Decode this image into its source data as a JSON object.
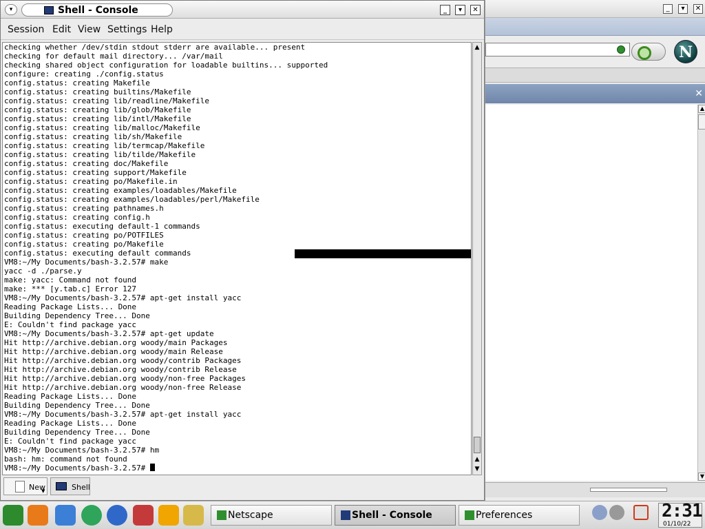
{
  "console_window": {
    "title": "Shell - Console",
    "menu": [
      "Session",
      "Edit",
      "View",
      "Settings",
      "Help"
    ],
    "lines": [
      "checking whether /dev/stdin stdout stderr are available... present",
      "checking for default mail directory... /var/mail",
      "checking shared object configuration for loadable builtins... supported",
      "configure: creating ./config.status",
      "config.status: creating Makefile",
      "config.status: creating builtins/Makefile",
      "config.status: creating lib/readline/Makefile",
      "config.status: creating lib/glob/Makefile",
      "config.status: creating lib/intl/Makefile",
      "config.status: creating lib/malloc/Makefile",
      "config.status: creating lib/sh/Makefile",
      "config.status: creating lib/termcap/Makefile",
      "config.status: creating lib/tilde/Makefile",
      "config.status: creating doc/Makefile",
      "config.status: creating support/Makefile",
      "config.status: creating po/Makefile.in",
      "config.status: creating examples/loadables/Makefile",
      "config.status: creating examples/loadables/perl/Makefile",
      "config.status: creating pathnames.h",
      "config.status: creating config.h",
      "config.status: executing default-1 commands",
      "config.status: creating po/POTFILES",
      "config.status: creating po/Makefile",
      "config.status: executing default commands",
      "VM8:~/My Documents/bash-3.2.57# make",
      "yacc -d ./parse.y",
      "make: yacc: Command not found",
      "make: *** [y.tab.c] Error 127",
      "VM8:~/My Documents/bash-3.2.57# apt-get install yacc",
      "Reading Package Lists... Done",
      "Building Dependency Tree... Done",
      "E: Couldn't find package yacc",
      "VM8:~/My Documents/bash-3.2.57# apt-get update",
      "Hit http://archive.debian.org woody/main Packages",
      "Hit http://archive.debian.org woody/main Release",
      "Hit http://archive.debian.org woody/contrib Packages",
      "Hit http://archive.debian.org woody/contrib Release",
      "Hit http://archive.debian.org woody/non-free Packages",
      "Hit http://archive.debian.org woody/non-free Release",
      "Reading Package Lists... Done",
      "Building Dependency Tree... Done",
      "VM8:~/My Documents/bash-3.2.57# apt-get install yacc",
      "Reading Package Lists... Done",
      "Building Dependency Tree... Done",
      "E: Couldn't find package yacc",
      "VM8:~/My Documents/bash-3.2.57# hm",
      "bash: hm: command not found"
    ],
    "prompt": "VM8:~/My Documents/bash-3.2.57# ",
    "tabs": {
      "new_label": "New",
      "shell_label": "Shell"
    }
  },
  "netscape_window": {
    "logo_letter": "N"
  },
  "taskbar": {
    "tasks": [
      {
        "label": "Netscape",
        "active": false
      },
      {
        "label": "Shell - Console",
        "active": true
      },
      {
        "label": "Preferences",
        "active": false
      }
    ],
    "clock": {
      "time": "2:31",
      "date": "01/10/22"
    }
  },
  "colors": {
    "terminal_bg": "#ffffff",
    "terminal_fg": "#000000",
    "sidebar_header": "#7f95b8"
  }
}
